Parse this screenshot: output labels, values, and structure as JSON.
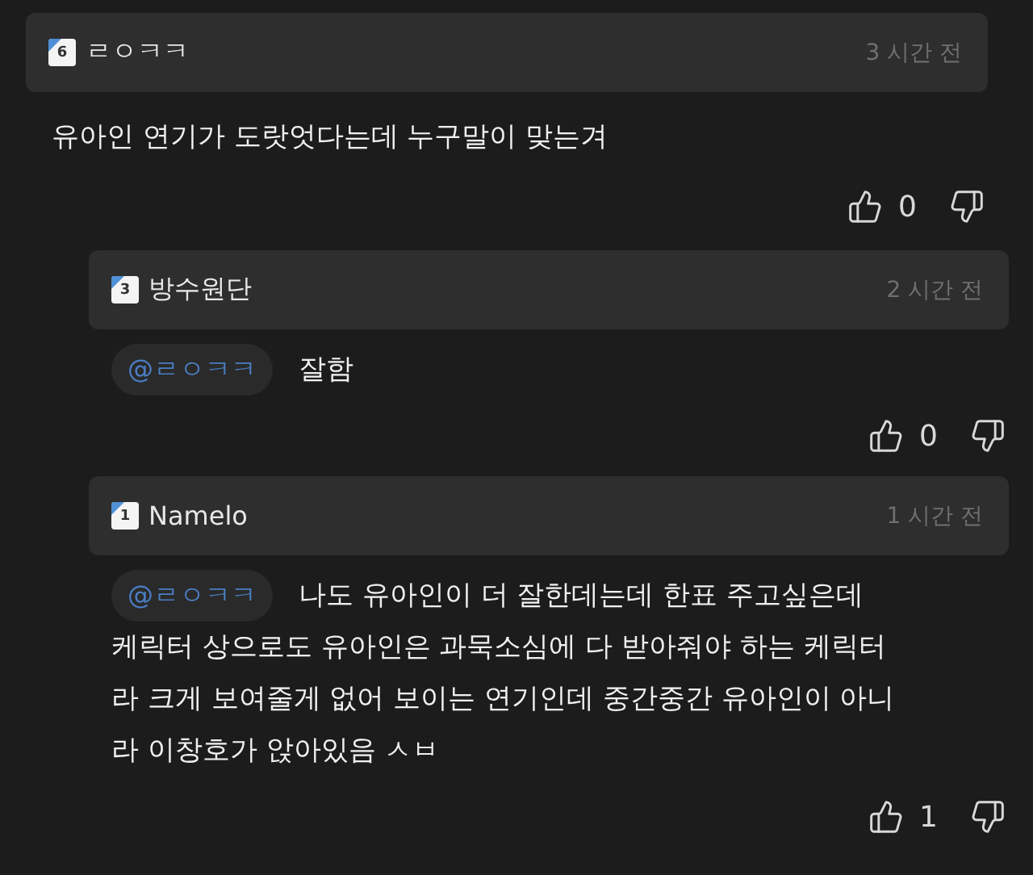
{
  "comments": [
    {
      "author": "ㄹㅇㅋㅋ",
      "level": "6",
      "time": "3 시간 전",
      "lines": [
        "유아인 연기가 도랏엇다는데 누구말이 맞는겨"
      ],
      "likes": "0",
      "reply": false
    },
    {
      "author": "방수원단",
      "level": "3",
      "time": "2 시간 전",
      "mention": "@ㄹㅇㅋㅋ",
      "lines": [
        "잘함"
      ],
      "likes": "0",
      "reply": true
    },
    {
      "author": "Namelo",
      "level": "1",
      "time": "1 시간 전",
      "mention": "@ㄹㅇㅋㅋ",
      "lines": [
        "나도 유아인이 더 잘한데는데 한표 주고싶은데",
        "케릭터 상으로도 유아인은 과묵소심에 다 받아줘야 하는 케릭터",
        "라 크게 보여줄게 없어 보이는 연기인데 중간중간 유아인이 아니",
        "라 이창호가 앉아있음 ㅅㅂ"
      ],
      "likes": "1",
      "reply": true
    }
  ]
}
